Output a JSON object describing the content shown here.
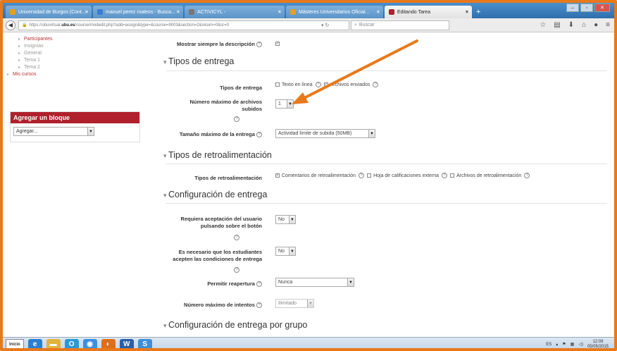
{
  "browser": {
    "tabs": [
      {
        "label": "Universidad de Burgos (Cont...",
        "color": "#e0a020",
        "active": false
      },
      {
        "label": "manuel perez mateos - Busca...",
        "color": "#3a7bd5",
        "active": false
      },
      {
        "label": "ACTIVICYL -",
        "color": "#777777",
        "active": false
      },
      {
        "label": "Másteres Universitarios Oficial...",
        "color": "#e0a020",
        "active": false
      },
      {
        "label": "Editando Tarea",
        "color": "#b0202d",
        "active": true
      }
    ],
    "url_prefix": "https://ubuvirtual.",
    "url_host": "ubu.es",
    "url_rest": "/course/modedit.php?add=assign&type=&course=9003&section=2&return=0&sr=0",
    "search_placeholder": "Buscar",
    "win_min": "–",
    "win_max": "▫",
    "win_close": "✕"
  },
  "nav": {
    "items": [
      {
        "label": "Participantes",
        "red": true
      },
      {
        "label": "Insignias",
        "red": false
      },
      {
        "label": "General",
        "red": false
      },
      {
        "label": "Tema 1",
        "red": false
      },
      {
        "label": "Tema 2",
        "red": false
      }
    ],
    "my_courses": "Mis cursos"
  },
  "block": {
    "title": "Agregar un bloque",
    "select_value": "Agregar..."
  },
  "form": {
    "show_desc_label": "Mostrar siempre la descripción",
    "sec1": "Tipos de entrega",
    "submission_types_label": "Tipos de entrega",
    "online_text": "Texto en línea",
    "file_submissions": "Archivos enviados",
    "max_files_label": "Número máximo de archivos subidos",
    "max_files_value": "1",
    "max_size_label": "Tamaño máximo de la entrega",
    "max_size_value": "Actividad límite de subida (50MB)",
    "sec2": "Tipos de retroalimentación",
    "feedback_types_label": "Tipos de retroalimentación",
    "feedback_comments": "Comentarios de retroalimentación",
    "feedback_offline": "Hoja de calificaciones externa",
    "feedback_files": "Archivos de retroalimentación",
    "sec3": "Configuración de entrega",
    "require_button_label": "Requiera aceptación del usuario pulsando sobre el botón",
    "require_button_value": "No",
    "require_statement_label": "Es necesario que los estudiantes acepten las condiciones de entrega",
    "require_statement_value": "No",
    "reopen_label": "Permitir reapertura",
    "reopen_value": "Nunca",
    "max_attempts_label": "Número máximo de intentos",
    "max_attempts_value": "Ilimitado",
    "sec4": "Configuración de entrega por grupo"
  },
  "taskbar": {
    "start": "Inicio",
    "lang": "ES",
    "time": "12:09",
    "date": "05/05/2015"
  },
  "accent": "#e8791b"
}
